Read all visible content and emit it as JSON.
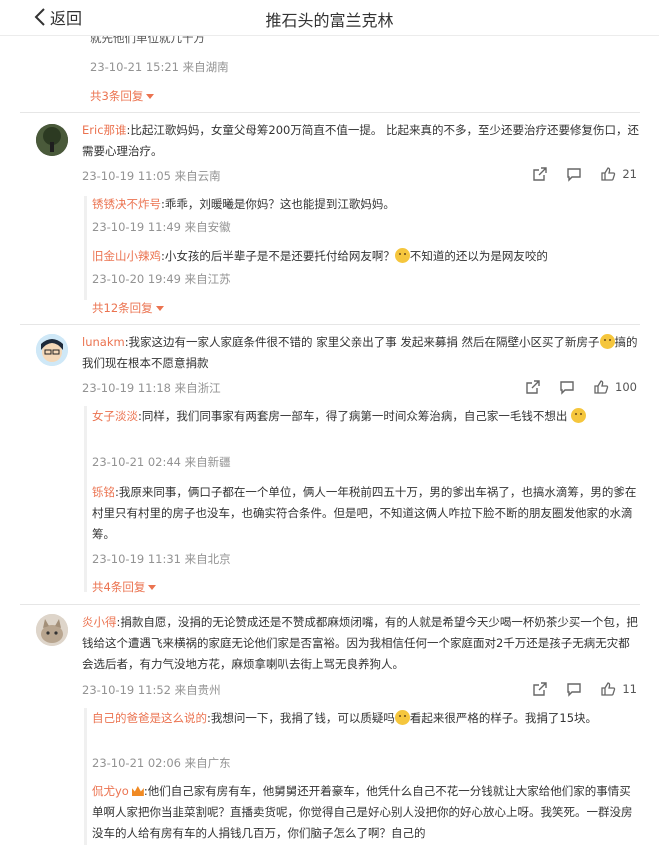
{
  "header": {
    "back_label": "返回",
    "title": "推石头的富兰克林"
  },
  "comments": [
    {
      "id": "c0",
      "text_tail": "就先他们单位就几十万",
      "time": "23-10-21 15:21 来自湖南",
      "more": "共3条回复"
    },
    {
      "id": "c1",
      "author": "Eric那谁",
      "text": ":比起江歌妈妈，女童父母筹200万简直不值一提。 比起来真的不多，至少还要治疗还要修复伤口，还需要心理治疗。",
      "time": "23-10-19 11:05 来自云南",
      "likes": "21",
      "replies": [
        {
          "author": "锈锈决不炸号",
          "text": ":乖乖，刘暖曦是你妈？这也能提到江歌妈妈。",
          "time": "23-10-19 11:49 来自安徽"
        },
        {
          "author": "旧金山小辣鸡",
          "text": ":小女孩的后半辈子是不是还要托付给网友啊？",
          "text_after": "不知道的还以为是网友咬的",
          "time": "23-10-20 19:49 来自江苏"
        }
      ],
      "more": "共12条回复"
    },
    {
      "id": "c2",
      "author": "lunakm",
      "text": ":我家这边有一家人家庭条件很不错的 家里父亲出了事 发起来募捐 然后在隔壁小区买了新房子",
      "text_after": "搞的我们现在根本不愿意捐款",
      "time": "23-10-19 11:18 来自浙江",
      "likes": "100",
      "replies": [
        {
          "author": "女子淡淡",
          "text": ":同样，我们同事家有两套房一部车，得了病第一时间众筹治病，自己家一毛钱不想出",
          "time": "23-10-21 02:44 来自新疆"
        },
        {
          "author": "铄铭",
          "text": ":我原来同事，俩口子都在一个单位，俩人一年税前四五十万，男的爹出车祸了，也搞水滴筹，男的爹在村里只有村里的房子也没车，也确实符合条件。但是吧，不知道这俩人咋拉下脸不断的朋友圈发他家的水滴筹。",
          "time": "23-10-19 11:31 来自北京"
        }
      ],
      "more": "共4条回复"
    },
    {
      "id": "c3",
      "author": "炎小得",
      "text": ":捐款自愿，没捐的无论赞成还是不赞成都麻烦闭嘴，有的人就是希望今天少喝一杯奶茶少买一个包，把钱给这个遭遇飞来横祸的家庭无论他们家是否富裕。因为我相信任何一个家庭面对2千万还是孩子无病无灾都会选后者，有力气没地方花，麻烦拿喇叭去街上骂无良养狗人。",
      "time": "23-10-19 11:52 来自贵州",
      "likes": "11",
      "replies": [
        {
          "author": "自己的爸爸是这么说的",
          "text": ":我想问一下，我捐了钱，可以质疑吗",
          "text_after": "看起来很严格的样子。我捐了15块。",
          "time": "23-10-21 02:06 来自广东"
        },
        {
          "author": "侃尤yo",
          "text": ":他们自己家有房有车，他舅舅还开着豪车，他凭什么自己不花一分钱就让大家给他们家的事情买单啊人家把你当韭菜割呢？直播卖货呢，你觉得自己是好心别人没把你的好心放心上呀。我笑死。一群没房没车的人给有房有车的人捐钱几百万，你们脑子怎么了啊？自己的"
        }
      ]
    }
  ]
}
